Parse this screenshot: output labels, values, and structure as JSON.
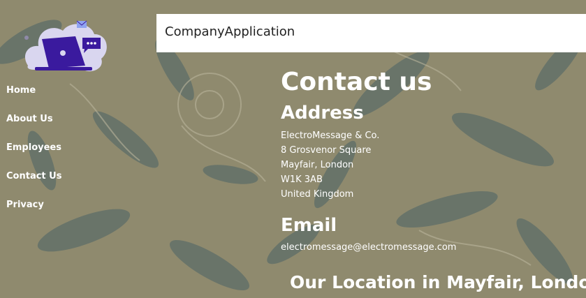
{
  "header": {
    "brand": "CompanyApplication"
  },
  "nav": {
    "items": [
      "Home",
      "About Us",
      "Employees",
      "Contact Us",
      "Privacy"
    ]
  },
  "contact": {
    "title": "Contact us",
    "address_heading": "Address",
    "address_lines": [
      "ElectroMessage & Co.",
      "8 Grosvenor Square",
      "Mayfair, London",
      "W1K 3AB",
      "United Kingdom"
    ],
    "email_heading": "Email",
    "email": "electromessage@electromessage.com",
    "location_heading": "Our Location in Mayfair, London"
  },
  "icons": {
    "logo": "laptop-chat-logo-icon"
  },
  "colors": {
    "logo_purple": "#3a1a9e",
    "logo_bubble": "#d9d6ef",
    "text": "#ffffff"
  }
}
